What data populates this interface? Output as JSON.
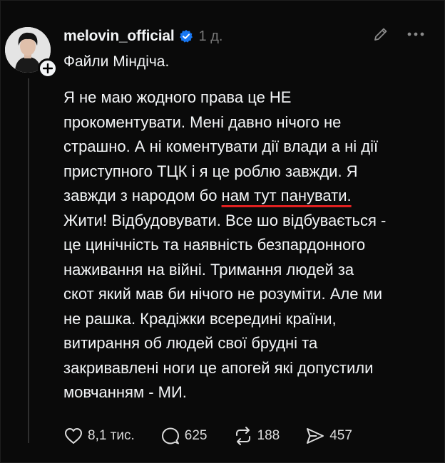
{
  "post": {
    "username": "melovin_official",
    "time": "1 д.",
    "subtitle": "Файли Міндіча.",
    "body_part1": "Я не маю жодного права це НЕ",
    "body_part2": "прокоментувати. Мені давно нічого не",
    "body_part3": "страшно. А ні коментувати дії влади а ні дії",
    "body_part4": "приступного ТЦК і я це роблю завжди. Я",
    "body_part5_pre": "завжди з народом бо ",
    "body_part5_underlined": "нам тут панувати.",
    "body_part6": "Жити! Відбудовувати. Все шо відбувається -",
    "body_part7": "це цинічність та наявність безпардонного",
    "body_part8": "наживання на війні. Тримання людей за",
    "body_part9": "скот який мав би нічого не розуміти. Але ми",
    "body_part10": "не рашка. Крадіжки всередині країни,",
    "body_part11": "витирання об людей свої брудні та",
    "body_part12": "закривавлені ноги це апогей які допустили",
    "body_part13": "мовчанням - МИ."
  },
  "actions": {
    "likes": "8,1 тис.",
    "comments": "625",
    "reposts": "188",
    "shares": "457"
  },
  "icons": [
    "heart-icon",
    "comment-icon",
    "repost-icon",
    "share-icon",
    "edit-icon",
    "more-icon",
    "verified-icon",
    "plus-icon"
  ],
  "colors": {
    "background": "#0a0a0a",
    "text": "#f3f5f7",
    "muted": "#777777",
    "verified": "#1877f2",
    "underline": "#e02020"
  }
}
